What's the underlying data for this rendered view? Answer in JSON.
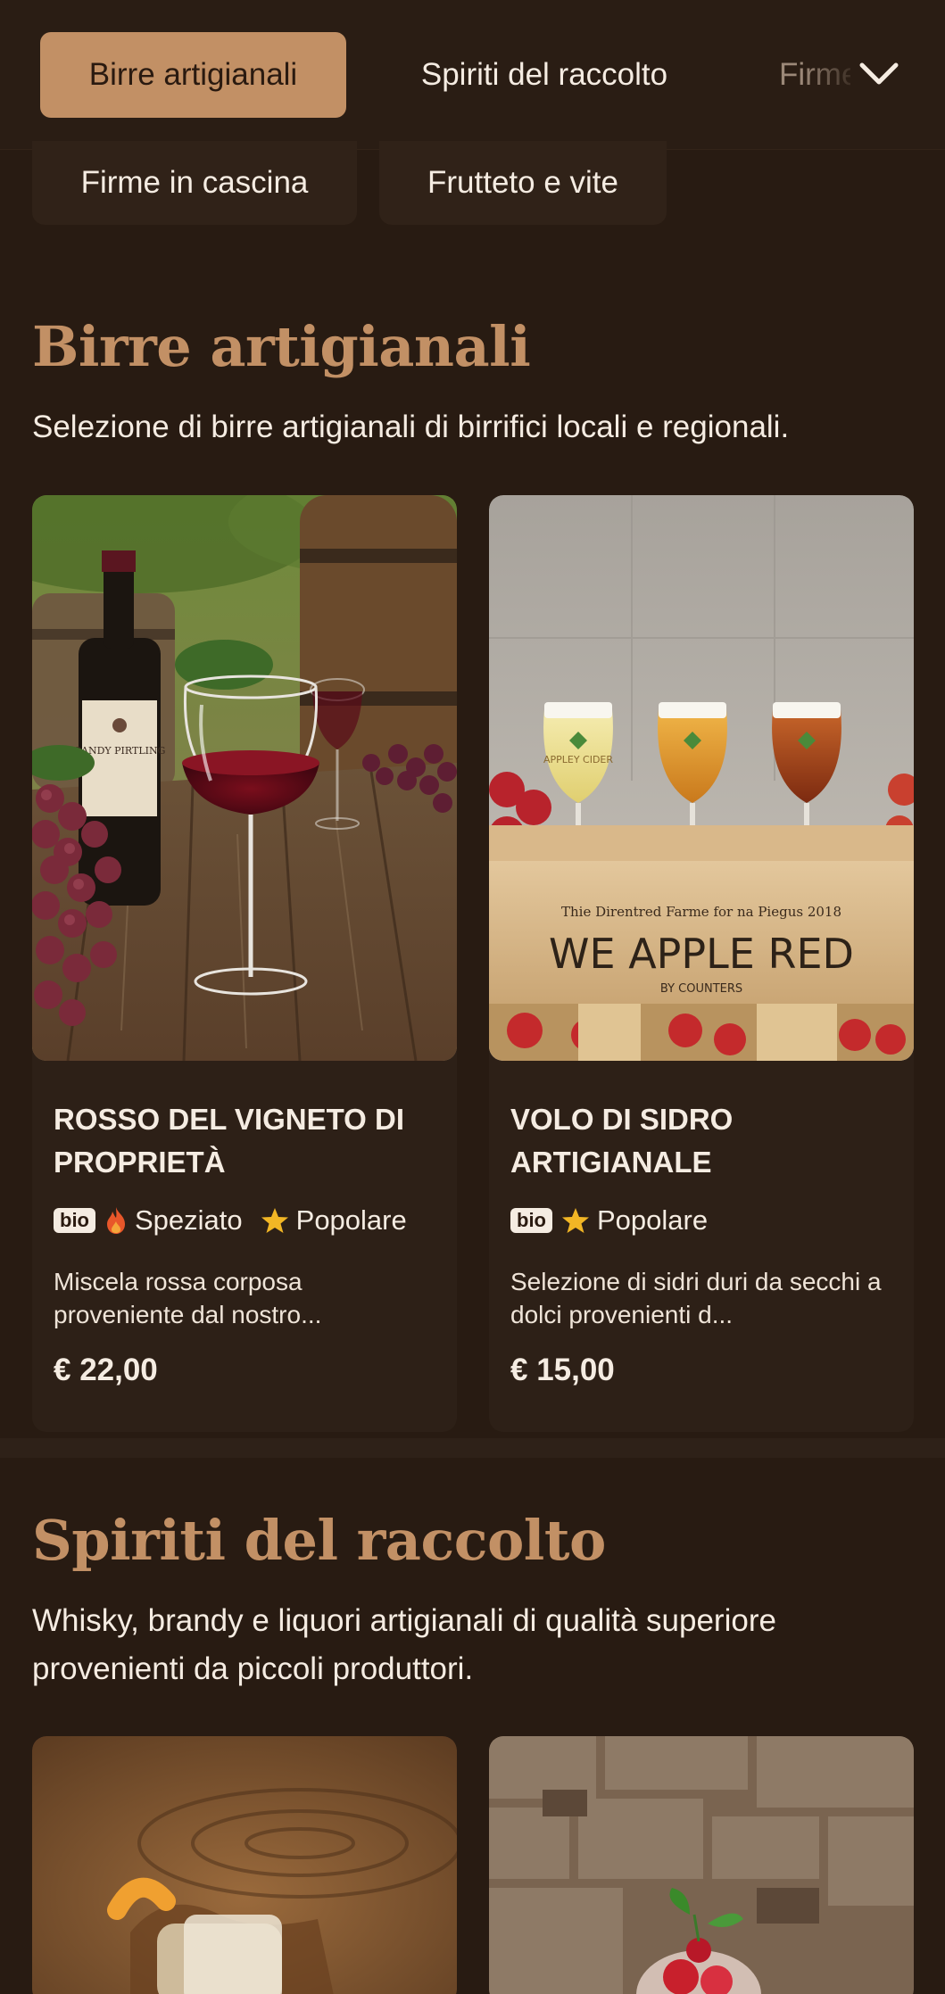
{
  "nav": {
    "tabs": [
      {
        "label": "Birre artigianali",
        "active": true
      },
      {
        "label": "Spiriti del raccolto",
        "active": false
      },
      {
        "label": "Firme in cascina",
        "active": false
      }
    ],
    "pills": [
      "Firme in cascina",
      "Frutteto e vite"
    ],
    "expand_icon": "chevron-down-icon"
  },
  "sections": [
    {
      "title": "Birre artigianali",
      "description": "Selezione di birre artigianali di birrifici locali e regionali.",
      "products": [
        {
          "name": "ROSSO DEL VIGNETO DI PROPRIETÀ",
          "badge": "bio",
          "tags": [
            {
              "icon": "flame-icon",
              "label": "Speziato"
            },
            {
              "icon": "star-icon",
              "label": "Popolare"
            }
          ],
          "description": "Miscela rossa corposa proveniente dal nostro...",
          "price": "€ 22,00",
          "image_text": {
            "bottle_label": "CANDY PIRTLING"
          }
        },
        {
          "name": "VOLO DI SIDRO ARTIGIANALE",
          "badge": "bio",
          "tags": [
            {
              "icon": "star-icon",
              "label": "Popolare"
            }
          ],
          "description": "Selezione di sidri duri da secchi a dolci provenienti d...",
          "price": "€ 15,00",
          "image_text": {
            "glass_label": "APPLEY CIDER",
            "crate_top": "Thie Direntred Farme for na Piegus 2018",
            "crate_main": "WE APPLE RED",
            "crate_sub": "BY COUNTERS"
          }
        }
      ]
    },
    {
      "title": "Spiriti del raccolto",
      "description": "Whisky, brandy e liquori artigianali di qualità superiore provenienti da piccoli produttori."
    }
  ],
  "colors": {
    "background": "#281b12",
    "accent": "#c29065",
    "card": "#2d2017",
    "text": "#f5ece2",
    "star": "#f2b625",
    "flame": "#e8572a"
  }
}
